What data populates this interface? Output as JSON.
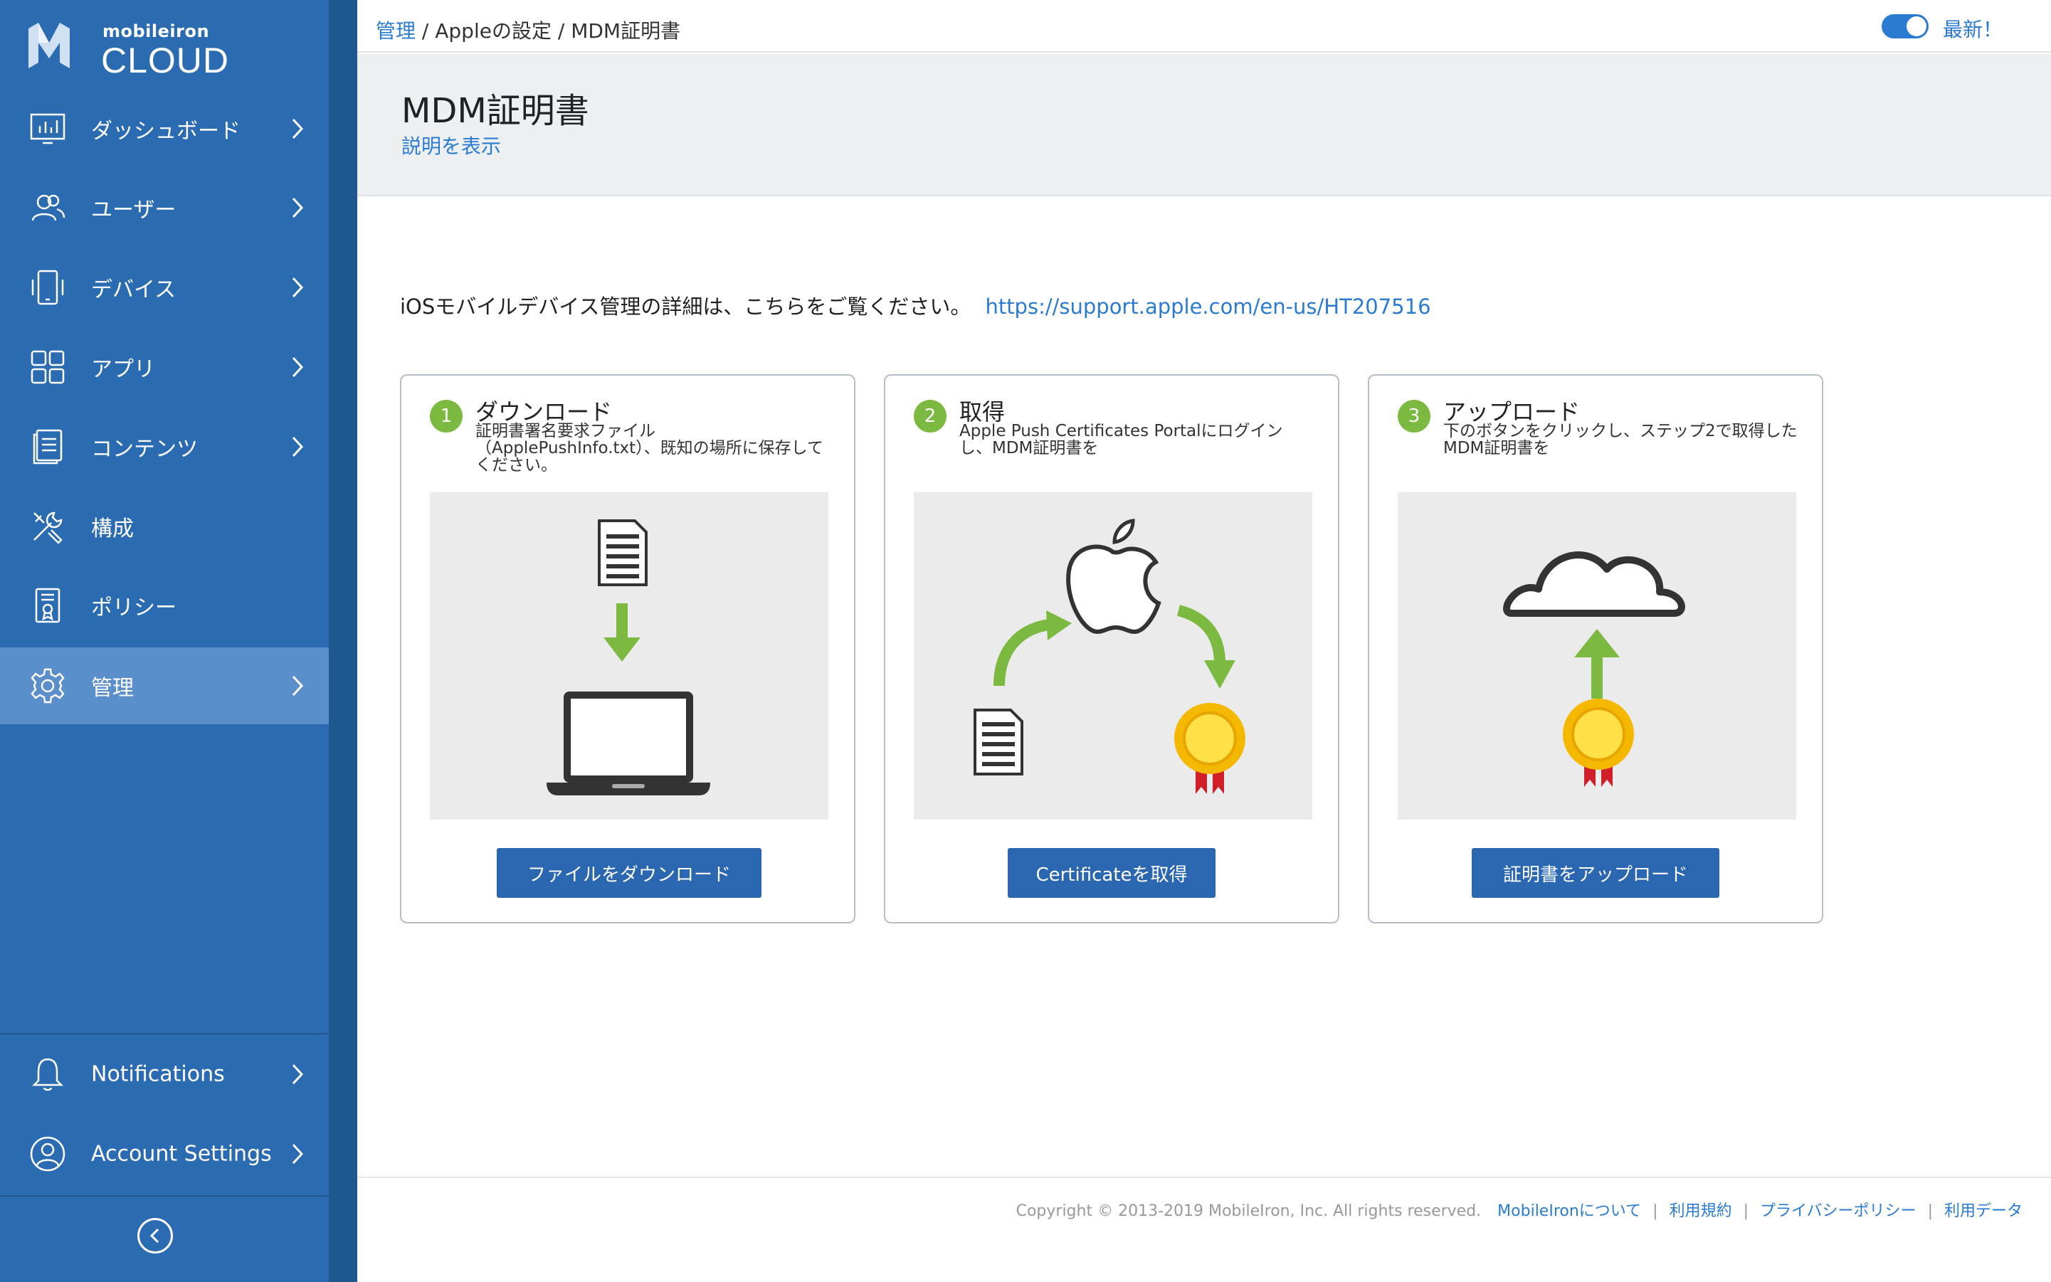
{
  "brand": {
    "small": "mobileiron",
    "big": "CLOUD"
  },
  "sidebar": {
    "items": [
      {
        "label": "ダッシュボード",
        "icon": "dashboard-icon"
      },
      {
        "label": "ユーザー",
        "icon": "users-icon"
      },
      {
        "label": "デバイス",
        "icon": "devices-icon"
      },
      {
        "label": "アプリ",
        "icon": "apps-icon"
      },
      {
        "label": "コンテンツ",
        "icon": "content-icon"
      },
      {
        "label": "構成",
        "icon": "tools-icon"
      },
      {
        "label": "ポリシー",
        "icon": "policy-icon"
      },
      {
        "label": "管理",
        "icon": "gear-icon",
        "active": true
      }
    ],
    "bottom_items": [
      {
        "label": "Notifications",
        "icon": "bell-icon"
      },
      {
        "label": "Account Settings",
        "icon": "account-icon"
      }
    ]
  },
  "topbar": {
    "breadcrumb": {
      "root": "管理",
      "rest": " / Appleの設定 / MDM証明書"
    },
    "latest_label": "最新！",
    "toggle_on": true
  },
  "header": {
    "title": "MDM証明書",
    "show_description": "説明を表示"
  },
  "intro": {
    "text": "iOSモバイルデバイス管理の詳細は、こちらをご覧ください。",
    "link": "https://support.apple.com/en-us/HT207516"
  },
  "steps": [
    {
      "number": "1",
      "title": "ダウンロード",
      "description": "証明書署名要求ファイル（ApplePushInfo.txt）、既知の場所に保存してください。",
      "button": "ファイルをダウンロード"
    },
    {
      "number": "2",
      "title": "取得",
      "description": "Apple Push Certificates Portalにログインし、MDM証明書を",
      "button": "Certificateを取得"
    },
    {
      "number": "3",
      "title": "アップロード",
      "description": "下のボタンをクリックし、ステップ2で取得したMDM証明書を",
      "button": "証明書をアップロード"
    }
  ],
  "footer": {
    "copyright": "Copyright © 2013-2019 MobileIron, Inc. All rights reserved.",
    "links": [
      "MobileIronについて",
      "利用規約",
      "プライバシーポリシー",
      "利用データ"
    ]
  },
  "colors": {
    "sidebar": "#2b6bb1",
    "sidebar_active": "#5b8fcc",
    "accent": "#2a7bd1",
    "button": "#2a67b0",
    "step_badge": "#7cb940"
  }
}
